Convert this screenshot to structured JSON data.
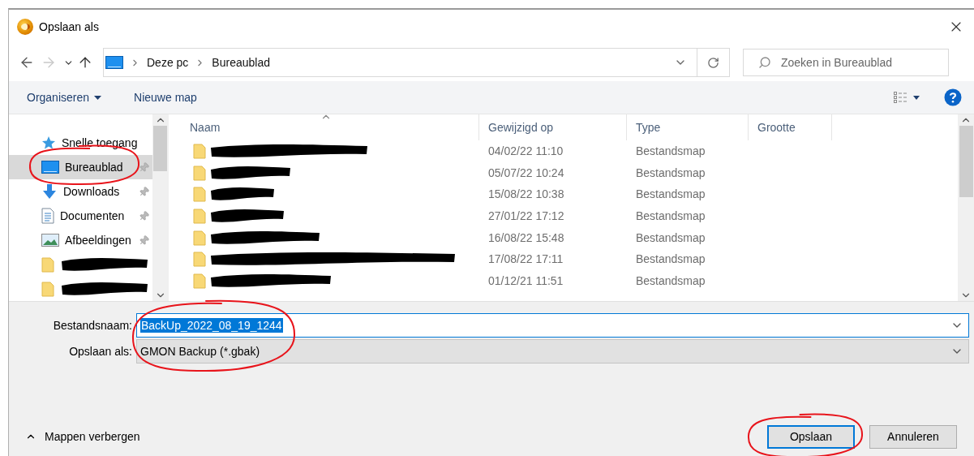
{
  "window": {
    "title": "Opslaan als"
  },
  "navigation": {
    "back_enabled": true,
    "forward_enabled": false
  },
  "address": {
    "path": [
      "Deze pc",
      "Bureaublad"
    ]
  },
  "search": {
    "placeholder": "Zoeken in Bureaublad"
  },
  "toolbar": {
    "organize": "Organiseren",
    "new_folder": "Nieuwe map"
  },
  "nav_pane": {
    "items": [
      {
        "kind": "quick-access",
        "label": "Snelle toegang",
        "selected": false,
        "pinned": false,
        "circled": false,
        "redacted": false
      },
      {
        "kind": "desktop",
        "label": "Bureaublad",
        "selected": true,
        "pinned": true,
        "circled": true,
        "redacted": false
      },
      {
        "kind": "downloads",
        "label": "Downloads",
        "selected": false,
        "pinned": true,
        "circled": false,
        "redacted": false
      },
      {
        "kind": "documents",
        "label": "Documenten",
        "selected": false,
        "pinned": true,
        "circled": false,
        "redacted": false
      },
      {
        "kind": "pictures",
        "label": "Afbeeldingen",
        "selected": false,
        "pinned": true,
        "circled": false,
        "redacted": false
      },
      {
        "kind": "folder",
        "selected": false,
        "pinned": false,
        "circled": false,
        "redacted": true
      },
      {
        "kind": "folder",
        "selected": false,
        "pinned": false,
        "circled": false,
        "redacted": true
      }
    ]
  },
  "file_list": {
    "columns": [
      {
        "label": "Naam",
        "sorted": true
      },
      {
        "label": "Gewijzigd op",
        "sorted": false
      },
      {
        "label": "Type",
        "sorted": false
      },
      {
        "label": "Grootte",
        "sorted": false
      }
    ],
    "rows": [
      {
        "redacted": true,
        "modified": "04/02/22 11:10",
        "type": "Bestandsmap"
      },
      {
        "redacted": true,
        "modified": "05/07/22 10:24",
        "type": "Bestandsmap"
      },
      {
        "redacted": true,
        "modified": "15/08/22 10:38",
        "type": "Bestandsmap"
      },
      {
        "redacted": true,
        "modified": "27/01/22 17:12",
        "type": "Bestandsmap"
      },
      {
        "redacted": true,
        "modified": "16/08/22 15:48",
        "type": "Bestandsmap"
      },
      {
        "redacted": true,
        "modified": "17/08/22 17:11",
        "type": "Bestandsmap"
      },
      {
        "redacted": true,
        "modified": "01/12/21 11:51",
        "type": "Bestandsmap"
      }
    ]
  },
  "form": {
    "circled": true,
    "filename": {
      "label": "Bestandsnaam:",
      "value": "BackUp_2022_08_19_1244",
      "text_selected": true
    },
    "filetype": {
      "label": "Opslaan als:",
      "value": "GMON Backup (*.gbak)"
    }
  },
  "footer": {
    "toggle": "Mappen verbergen",
    "buttons": [
      {
        "label": "Opslaan",
        "default": true,
        "circled": true
      },
      {
        "label": "Annuleren",
        "default": false,
        "circled": false
      }
    ]
  }
}
